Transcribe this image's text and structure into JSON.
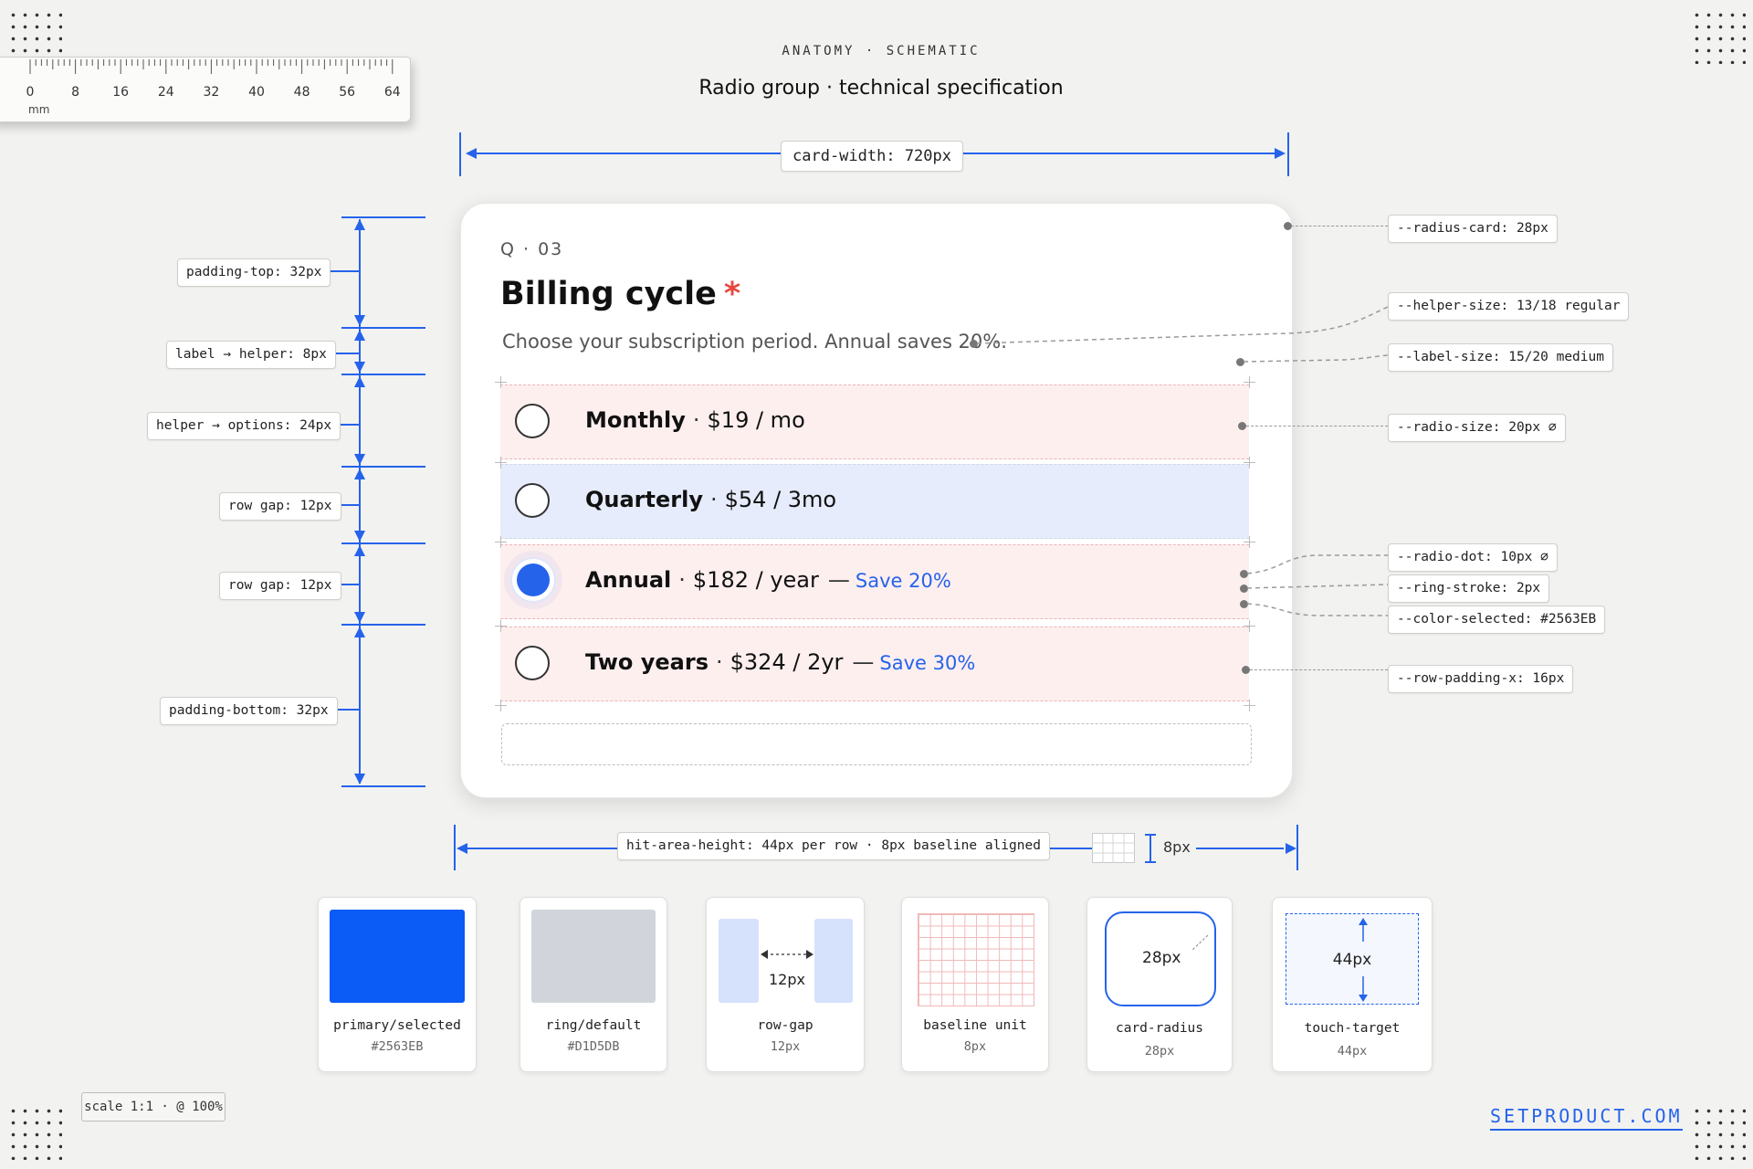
{
  "header": {
    "eyebrow": "ANATOMY · SCHEMATIC",
    "title": "Radio group · technical specification"
  },
  "ruler": {
    "ticks": [
      "0",
      "8",
      "16",
      "24",
      "32",
      "40",
      "48",
      "56",
      "64"
    ],
    "unit": "mm"
  },
  "dimensions": {
    "card_width": "card-width: 720px",
    "hit_area": "hit-area-height: 44px per row · 8px baseline aligned",
    "baseline_small": "8px",
    "left": {
      "padding_top": "padding-top: 32px",
      "label_helper": "label → helper: 8px",
      "helper_options": "helper → options: 24px",
      "row_gap_1": "row gap: 12px",
      "row_gap_2": "row gap: 12px",
      "padding_bottom": "padding-bottom: 32px"
    }
  },
  "card": {
    "question_number": "Q · 03",
    "label": "Billing cycle",
    "required_mark": "*",
    "helper": "Choose your subscription period. Annual saves 20%.",
    "options": [
      {
        "name": "Monthly",
        "price": "$19 / mo",
        "save": "",
        "selected": false
      },
      {
        "name": "Quarterly",
        "price": "$54 / 3mo",
        "save": "",
        "selected": false
      },
      {
        "name": "Annual",
        "price": "$182 / year",
        "save": "Save 20%",
        "selected": true
      },
      {
        "name": "Two years",
        "price": "$324 / 2yr",
        "save": "Save 30%",
        "selected": false
      }
    ]
  },
  "tokens": {
    "radius_card": "--radius-card: 28px",
    "helper_size": "--helper-size: 13/18 regular",
    "label_size": "--label-size: 15/20 medium",
    "radio_size": "--radio-size: 20px ∅",
    "radio_dot": "--radio-dot: 10px ∅",
    "ring_stroke": "--ring-stroke: 2px",
    "color_selected": "--color-selected: #2563EB",
    "row_padding_x": "--row-padding-x: 16px"
  },
  "tiles": [
    {
      "name": "primary/selected",
      "value": "#2563EB",
      "color": "#0B5BF6"
    },
    {
      "name": "ring/default",
      "value": "#D1D5DB",
      "color": "#D1D5DB"
    },
    {
      "name": "row-gap",
      "value": "12px",
      "inner": "12px"
    },
    {
      "name": "baseline unit",
      "value": "8px"
    },
    {
      "name": "card-radius",
      "value": "28px",
      "inner": "28px"
    },
    {
      "name": "touch-target",
      "value": "44px",
      "inner": "44px"
    }
  ],
  "footer": {
    "scale": "scale 1:1 · @ 100%",
    "brand": "SETPRODUCT.COM"
  },
  "colors": {
    "accent": "#2563EB",
    "required": "#E5483E"
  }
}
